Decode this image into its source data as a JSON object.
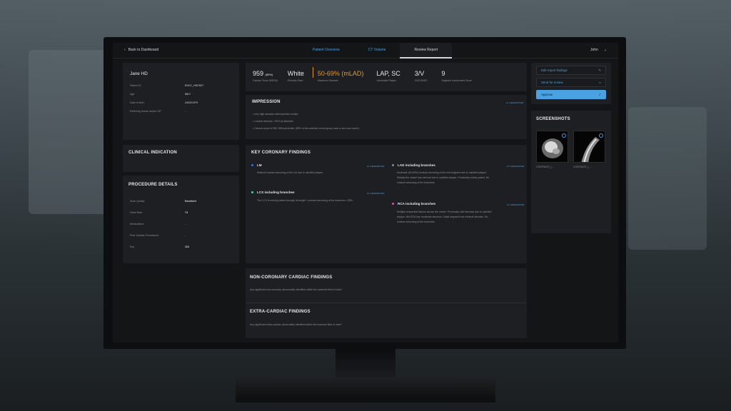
{
  "nav": {
    "back_label": "Back to Dashboard",
    "tabs": [
      {
        "label": "Patient Overview"
      },
      {
        "label": "CT Volume"
      },
      {
        "label": "Review Report"
      }
    ],
    "user_name": "John"
  },
  "patient": {
    "name": "Jane HD",
    "rows": [
      {
        "label": "Patient ID",
        "value": "ENVC_HID7827"
      },
      {
        "label": "Age",
        "value": "88LY"
      },
      {
        "label": "Date of birth",
        "value": "24/02/1979"
      },
      {
        "label": "Referring Doctor and/or GP",
        "value": "-"
      }
    ]
  },
  "metrics": [
    {
      "value": "959",
      "suffix": "(89%)",
      "label": "Calcium Score (MESA)"
    },
    {
      "value": "White",
      "suffix": "",
      "label": "Ethnicity Race"
    },
    {
      "value": "50-69% (mLAD)",
      "suffix": "",
      "label": "Maximum Stenosis"
    },
    {
      "value": "LAP, SC",
      "suffix": "",
      "label": "Vulnerable Plaque"
    },
    {
      "value": "3/V",
      "suffix": "",
      "label": "CAD-RADS"
    },
    {
      "value": "9",
      "suffix": "",
      "label": "Segment Involvement Score"
    }
  ],
  "impression": {
    "title": "IMPRESSION",
    "tag": "AI GENERATED",
    "bullets": [
      "Very high absolute atheroscelotic burden.",
      "Luminal stenosis > 50% by diameter.",
      "Calcium score of 959, 89th percentile. (89% of the matched control group have a zero core score)."
    ]
  },
  "clinical": {
    "title": "CLINICAL INDICATION"
  },
  "procedure": {
    "title": "PROCEDURE DETAILS",
    "rows": [
      {
        "label": "Scan Quality",
        "value": "Excellent"
      },
      {
        "label": "Heart Rate",
        "value": "74"
      },
      {
        "label": "Medications",
        "value": "-"
      },
      {
        "label": "Prior Cardiac Procedures",
        "value": "-"
      },
      {
        "label": "Kvp",
        "value": "110"
      }
    ]
  },
  "coronary": {
    "title": "KEY CORONARY FINDINGS",
    "tag": "AI GENERATED",
    "findings": [
      {
        "name": "LM",
        "color": "#3f6fe0",
        "text": [
          "Minimal luminal narrowing of the LM due to calcified plaque."
        ]
      },
      {
        "name": "LCX including branches",
        "color": "#3fd6a8",
        "text": [
          "The LCX is entirely patent through its length. Luminal narrowing of the branches <25%."
        ]
      },
      {
        "name": "LAD including branches",
        "color": "#8a8f96",
        "text": [
          "Moderate (50-69%) luminal narrowing of the mid segment due to calcified plaque.",
          "Distally the vessel has minimal due to calcified plaque. Proximally widely patent. No",
          "luminal narrowing of the branches."
        ]
      },
      {
        "name": "RCA including branches",
        "color": "#e04bb0",
        "text": [
          "Multiple sequential lesions across the vessel. Proximally mild stenosis due to calcified",
          "plaque. Mid RCA has moderate stenosis. Distal segment has minimal stenosis. No",
          "luminal narrowing of the branches."
        ]
      }
    ]
  },
  "noncoronary": {
    "title": "NON-CORONARY CARDIAC FINDINGS",
    "question": "Any significant non-coronary abnormality identified within the scanned field of view?"
  },
  "extracardiac": {
    "title": "EXTRA-CARDIAC FINDINGS",
    "question": "Any significant extra-cardiac abnormality identified within the scanned field of view?"
  },
  "actions": [
    {
      "label": "Edit report findings",
      "icon": "pencil-icon"
    },
    {
      "label": "Send for review",
      "icon": "link-icon"
    },
    {
      "label": "Approve",
      "icon": "check-circle-icon"
    }
  ],
  "screenshots": {
    "title": "SCREENSHOTS",
    "items": [
      {
        "label": "CONTRAST_(…"
      },
      {
        "label": "CONTRAST_(…"
      }
    ]
  },
  "colors": {
    "accent": "#4aa2e3",
    "warning": "#e0973a",
    "panel": "#1e1f22"
  }
}
